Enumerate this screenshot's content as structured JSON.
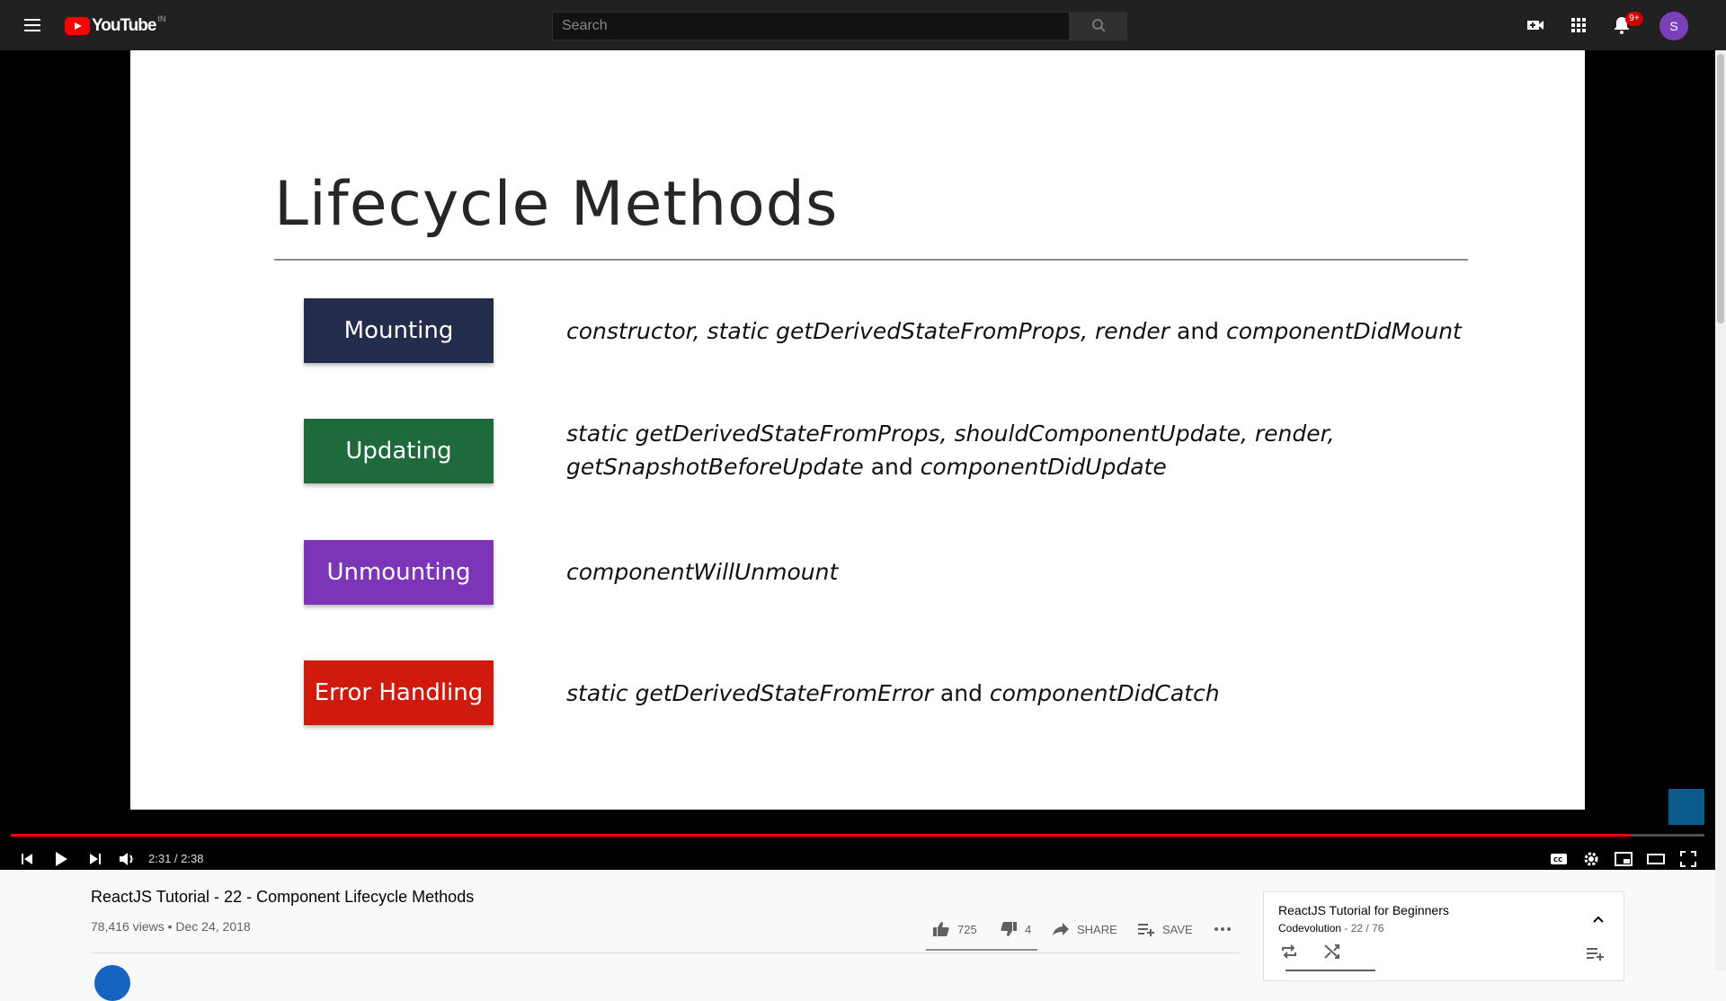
{
  "masthead": {
    "logo_text": "YouTube",
    "country_code": "IN",
    "search_placeholder": "Search",
    "notification_count": "9+",
    "avatar_letter": "S"
  },
  "slide": {
    "title": "Lifecycle Methods",
    "phases": [
      {
        "label": "Mounting",
        "color": "#232d4b",
        "methods_html": "<i>constructor, static getDerivedStateFromProps, render</i> and <i>componentDidMount</i>"
      },
      {
        "label": "Updating",
        "color": "#1f6a3c",
        "methods_html": "<i>static getDerivedStateFromProps, shouldComponentUpdate, render,</i><br><i>getSnapshotBeforeUpdate</i> and <i>componentDidUpdate</i>"
      },
      {
        "label": "Unmounting",
        "color": "#7d35b8",
        "methods_html": "<i>componentWillUnmount</i>"
      },
      {
        "label": "Error Handling",
        "color": "#d11a0e",
        "methods_html": "<i>static getDerivedStateFromError</i> and <i>componentDidCatch</i>"
      }
    ]
  },
  "player": {
    "time": "2:31 / 2:38",
    "progress": 0.956
  },
  "video": {
    "title": "ReactJS Tutorial - 22 - Component Lifecycle Methods",
    "meta": "78,416 views • Dec 24, 2018",
    "likes": "725",
    "dislikes": "4",
    "share_label": "SHARE",
    "save_label": "SAVE"
  },
  "playlist": {
    "title": "ReactJS Tutorial for Beginners",
    "channel": "Codevolution",
    "position": " - 22 / 76"
  },
  "colors": {
    "masthead_bg": "#212121",
    "progress": "#ff0000",
    "avatar": "#7b3fb9"
  }
}
